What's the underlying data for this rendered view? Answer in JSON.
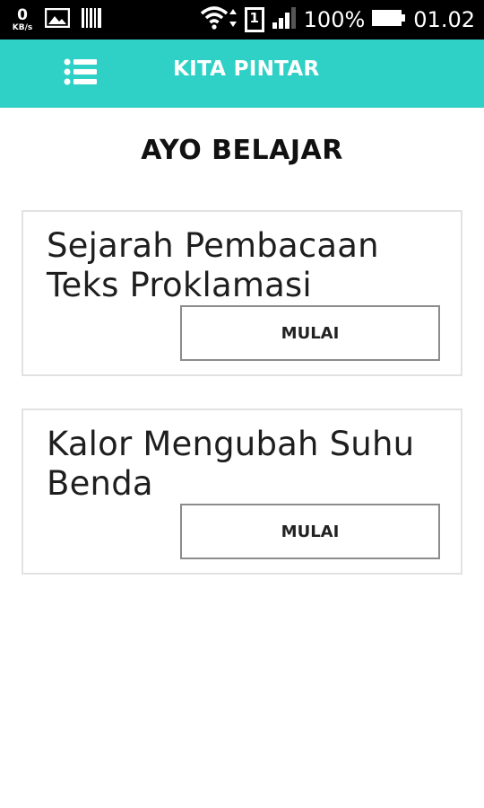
{
  "status_bar": {
    "speed_value": "0",
    "speed_unit": "KB/s",
    "battery": "100%",
    "time": "01.02",
    "sim_slot": "1"
  },
  "app_bar": {
    "title": "KITA PINTAR"
  },
  "main": {
    "heading": "AYO BELAJAR",
    "lessons": [
      {
        "title": "Sejarah Pembacaan Teks Proklamasi",
        "button_label": "MULAI"
      },
      {
        "title": "Kalor Mengubah Suhu Benda",
        "button_label": "MULAI"
      }
    ]
  },
  "colors": {
    "accent": "#2fd0c6",
    "status_bar": "#000000"
  },
  "icons": [
    "hamburger-menu-icon",
    "image-icon",
    "barcode-icon",
    "wifi-icon",
    "sim-icon",
    "signal-icon",
    "battery-icon"
  ]
}
